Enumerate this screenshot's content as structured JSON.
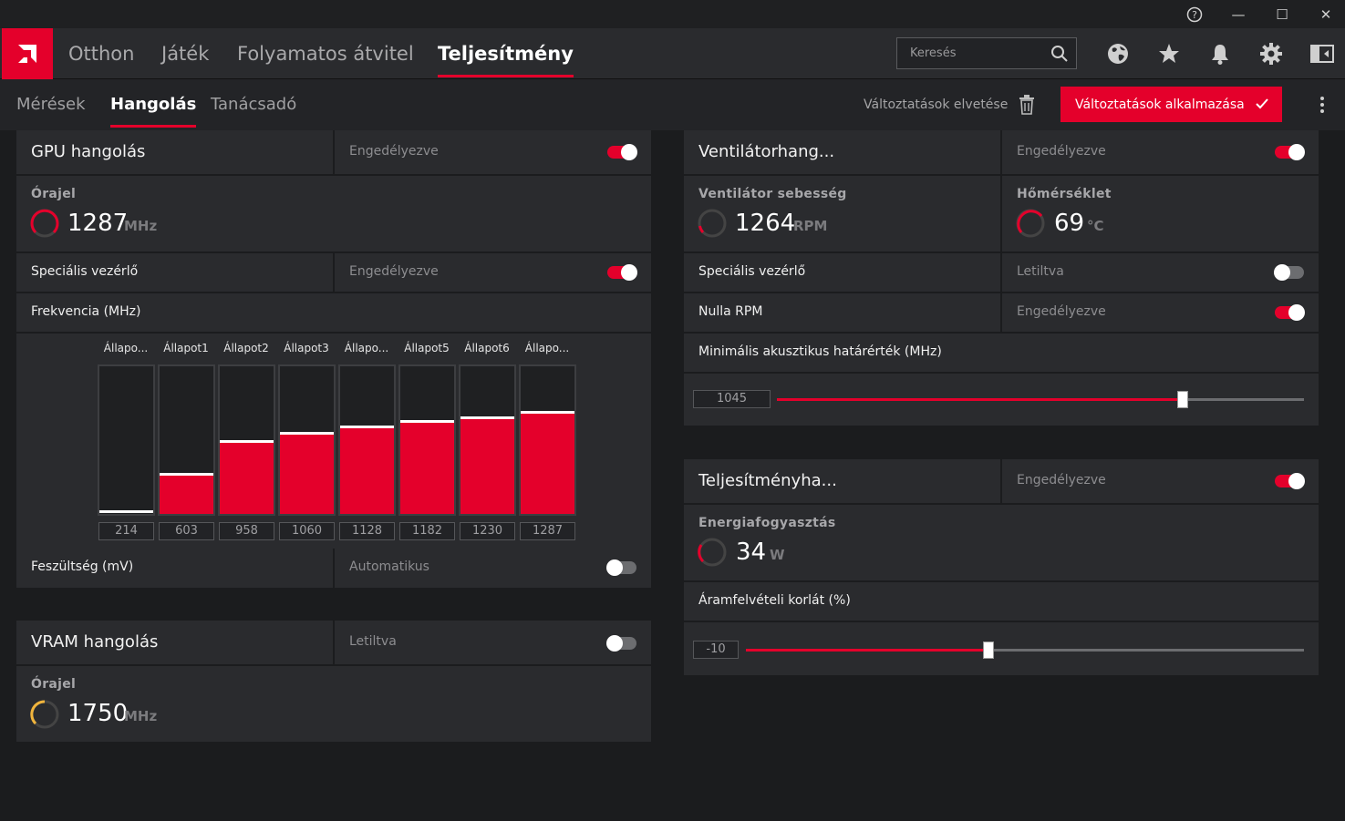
{
  "window": {
    "help_glyph": "?",
    "minimize_glyph": "—",
    "maximize_glyph": "☐",
    "close_glyph": "✕"
  },
  "main_nav": {
    "tabs": [
      {
        "label": "Otthon"
      },
      {
        "label": "Játék"
      },
      {
        "label": "Folyamatos átvitel"
      },
      {
        "label": "Teljesítmény"
      }
    ],
    "search_placeholder": "Keresés",
    "icons": [
      "globe-icon",
      "star-icon",
      "bell-icon",
      "gear-icon",
      "sidebar-panel-icon"
    ]
  },
  "sub_nav": {
    "tabs": [
      {
        "label": "Mérések"
      },
      {
        "label": "Hangolás"
      },
      {
        "label": "Tanácsadó"
      }
    ],
    "discard_label": "Változtatások elvetése",
    "apply_label": "Változtatások alkalmazása"
  },
  "colors": {
    "accent": "#e4002b",
    "vram_gauge": "#f0b43c"
  },
  "gpu": {
    "title": "GPU hangolás",
    "status": "Engedélyezve",
    "enabled": true,
    "clock_label": "Órajel",
    "clock_value": "1287",
    "clock_unit": "MHz",
    "special_label": "Speciális vezérlő",
    "special_status": "Engedélyezve",
    "special_enabled": true,
    "freq_label": "Frekvencia (MHz)",
    "states": [
      {
        "label": "Állapo...",
        "value": "214",
        "level": 0.0
      },
      {
        "label": "Állapot1",
        "value": "603",
        "level": 0.26
      },
      {
        "label": "Állapot2",
        "value": "958",
        "level": 0.48
      },
      {
        "label": "Állapot3",
        "value": "1060",
        "level": 0.54
      },
      {
        "label": "Állapo...",
        "value": "1128",
        "level": 0.58
      },
      {
        "label": "Állapot5",
        "value": "1182",
        "level": 0.62
      },
      {
        "label": "Állapot6",
        "value": "1230",
        "level": 0.64
      },
      {
        "label": "Állapo...",
        "value": "1287",
        "level": 0.68
      }
    ],
    "voltage_label": "Feszültség (mV)",
    "voltage_status": "Automatikus",
    "voltage_enabled": false
  },
  "vram": {
    "title": "VRAM hangolás",
    "status": "Letiltva",
    "enabled": false,
    "clock_label": "Órajel",
    "clock_value": "1750",
    "clock_unit": "MHz"
  },
  "fan": {
    "title": "Ventilátorhang...",
    "status": "Engedélyezve",
    "enabled": true,
    "speed_label": "Ventilátor sebesség",
    "speed_value": "1264",
    "speed_unit": "RPM",
    "temp_label": "Hőmérséklet",
    "temp_value": "69",
    "temp_unit": "°C",
    "special_label": "Speciális vezérlő",
    "special_status": "Letiltva",
    "special_enabled": false,
    "zero_rpm_label": "Nulla RPM",
    "zero_rpm_status": "Engedélyezve",
    "zero_rpm_enabled": true,
    "min_acoustic_label": "Minimális akusztikus határérték (MHz)",
    "min_acoustic_value": "1045",
    "min_acoustic_fraction": 0.77
  },
  "power": {
    "title": "Teljesítményha...",
    "status": "Engedélyezve",
    "enabled": true,
    "consumption_label": "Energiafogyasztás",
    "consumption_value": "34",
    "consumption_unit": "W",
    "limit_label": "Áramfelvételi korlát (%)",
    "limit_value": "-10",
    "limit_fraction": 0.435
  }
}
